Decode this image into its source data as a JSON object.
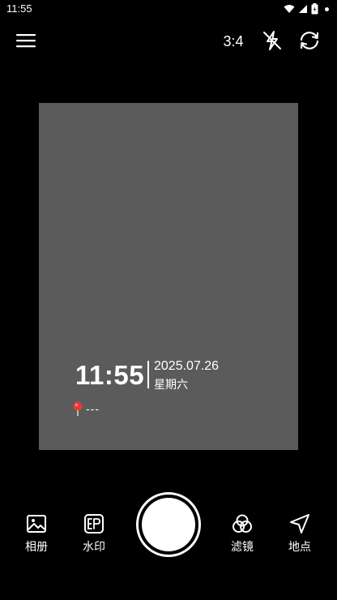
{
  "status_bar": {
    "time": "11:55"
  },
  "top_bar": {
    "menu_icon": "hamburger-menu-icon",
    "aspect_ratio": "3:4",
    "flash_icon": "flash-off-icon",
    "switch_icon": "switch-camera-icon"
  },
  "watermark": {
    "time": "11:55",
    "date": "2025.07.26",
    "weekday": "星期六",
    "location": "---",
    "pin_icon": "location-pin-icon"
  },
  "bottom_bar": {
    "album": {
      "label": "相册",
      "icon": "image-icon"
    },
    "watermark": {
      "label": "水印",
      "icon": "watermark-icon"
    },
    "filter": {
      "label": "滤镜",
      "icon": "filter-icon"
    },
    "location": {
      "label": "地点",
      "icon": "navigation-icon"
    }
  },
  "colors": {
    "background": "#000000",
    "viewfinder": "#5b5b5b",
    "pin": "#e53935"
  }
}
